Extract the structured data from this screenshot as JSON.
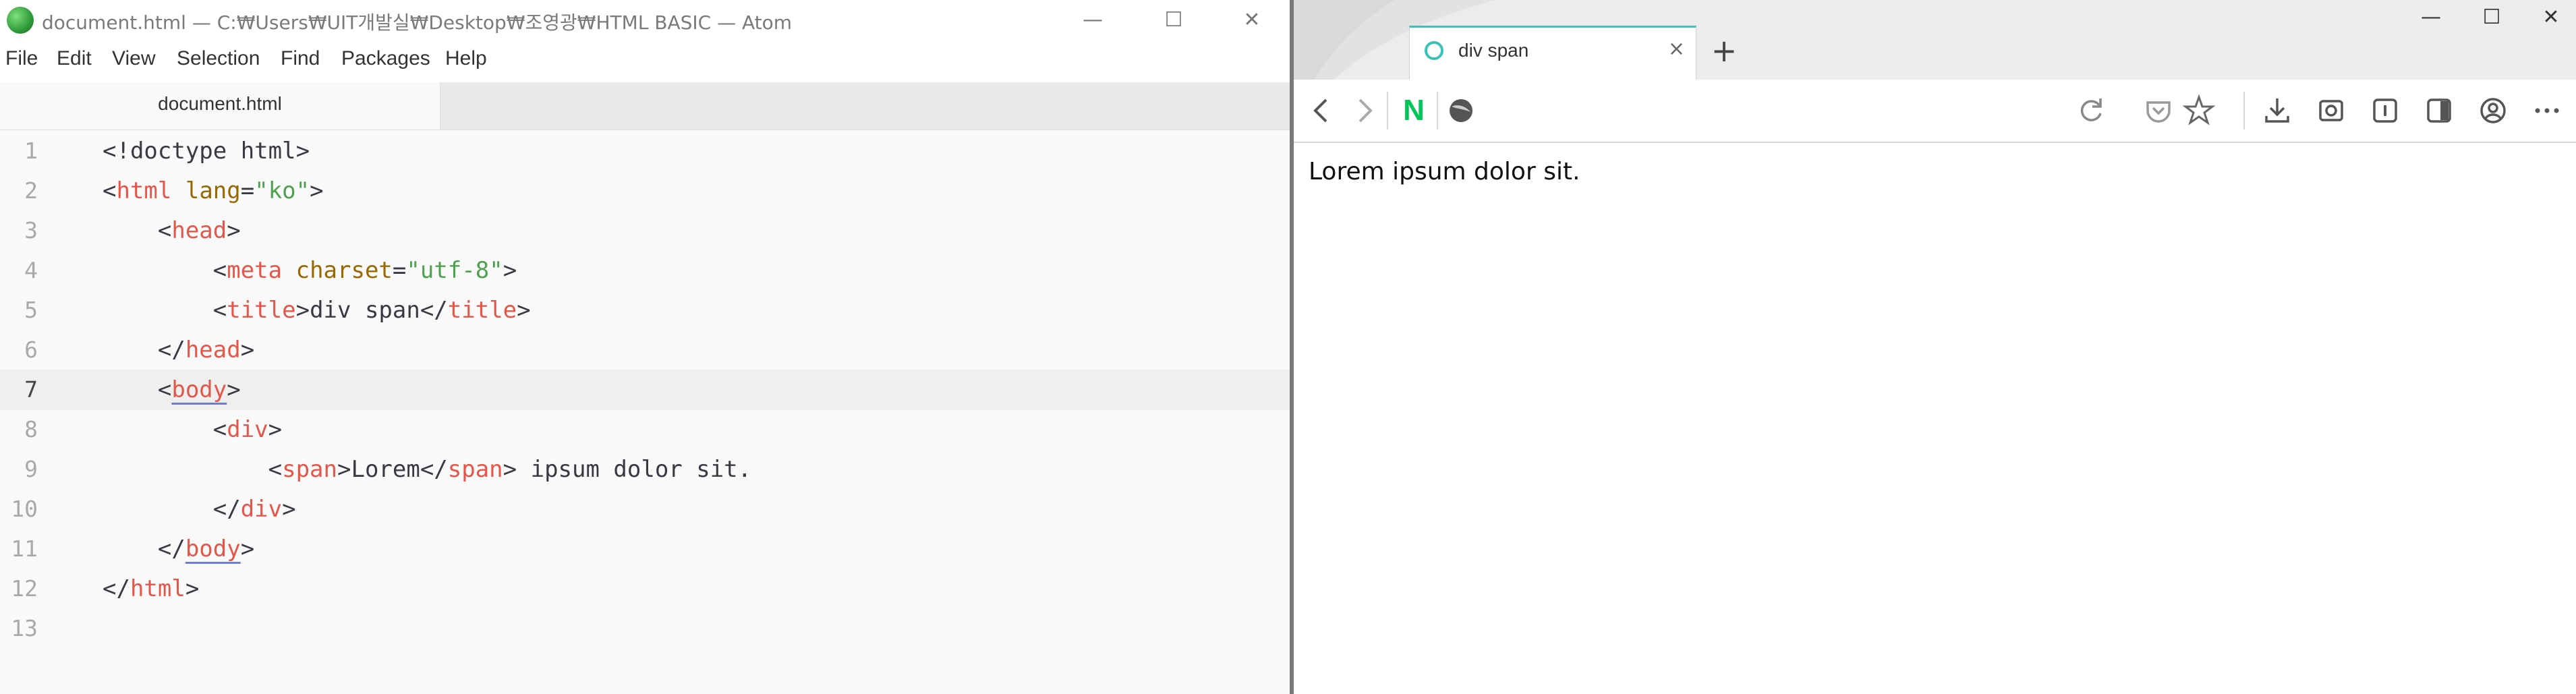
{
  "editor_window": {
    "title": "document.html — C:₩Users₩UIT개발실₩Desktop₩조영광₩HTML BASIC — Atom",
    "controls": {
      "minimize": "—",
      "maximize": "☐",
      "close": "✕"
    }
  },
  "menubar": {
    "items": [
      "File",
      "Edit",
      "View",
      "Selection",
      "Find",
      "Packages",
      "Help"
    ]
  },
  "editor_tab": {
    "label": "document.html"
  },
  "code_lines": [
    {
      "n": "1",
      "tokens": [
        [
          "p",
          "<!doctype html>"
        ]
      ]
    },
    {
      "n": "2",
      "tokens": [
        [
          "p",
          "<"
        ],
        [
          "t",
          "html"
        ],
        [
          "p",
          " "
        ],
        [
          "a",
          "lang"
        ],
        [
          "p",
          "="
        ],
        [
          "s",
          "\"ko\""
        ],
        [
          "p",
          ">"
        ]
      ]
    },
    {
      "n": "3",
      "tokens": [
        [
          "p",
          "    <"
        ],
        [
          "t",
          "head"
        ],
        [
          "p",
          ">"
        ]
      ]
    },
    {
      "n": "4",
      "tokens": [
        [
          "p",
          "        <"
        ],
        [
          "t",
          "meta"
        ],
        [
          "p",
          " "
        ],
        [
          "a",
          "charset"
        ],
        [
          "p",
          "="
        ],
        [
          "s",
          "\"utf-8\""
        ],
        [
          "p",
          ">"
        ]
      ]
    },
    {
      "n": "5",
      "tokens": [
        [
          "p",
          "        <"
        ],
        [
          "t",
          "title"
        ],
        [
          "p",
          ">div span</"
        ],
        [
          "t",
          "title"
        ],
        [
          "p",
          ">"
        ]
      ]
    },
    {
      "n": "6",
      "tokens": [
        [
          "p",
          "    </"
        ],
        [
          "t",
          "head"
        ],
        [
          "p",
          ">"
        ]
      ]
    },
    {
      "n": "7",
      "tokens": [
        [
          "p",
          "    <"
        ],
        [
          "tu",
          "body"
        ],
        [
          "p",
          ">"
        ]
      ]
    },
    {
      "n": "8",
      "tokens": [
        [
          "p",
          "        <"
        ],
        [
          "t",
          "div"
        ],
        [
          "p",
          ">"
        ]
      ]
    },
    {
      "n": "9",
      "tokens": [
        [
          "p",
          "            <"
        ],
        [
          "t",
          "span"
        ],
        [
          "p",
          ">Lorem</"
        ],
        [
          "t",
          "span"
        ],
        [
          "p",
          "> ipsum dolor sit."
        ]
      ]
    },
    {
      "n": "10",
      "tokens": [
        [
          "p",
          "        </"
        ],
        [
          "t",
          "div"
        ],
        [
          "p",
          ">"
        ]
      ]
    },
    {
      "n": "11",
      "tokens": [
        [
          "p",
          "    </"
        ],
        [
          "tu",
          "body"
        ],
        [
          "p",
          ">"
        ]
      ]
    },
    {
      "n": "12",
      "tokens": [
        [
          "p",
          "</"
        ],
        [
          "t",
          "html"
        ],
        [
          "p",
          ">"
        ]
      ]
    },
    {
      "n": "13",
      "tokens": []
    }
  ],
  "active_line": "7",
  "browser": {
    "tab_title": "div span",
    "tab_close": "×",
    "new_tab": "+",
    "controls": {
      "minimize": "—",
      "maximize": "☐",
      "close": "✕"
    },
    "page_text": "Lorem ipsum dolor sit.",
    "naver_label": "N"
  },
  "colors": {
    "tag": "#e45649",
    "attr": "#986801",
    "string": "#50a14f",
    "accent": "#39c3b8"
  }
}
